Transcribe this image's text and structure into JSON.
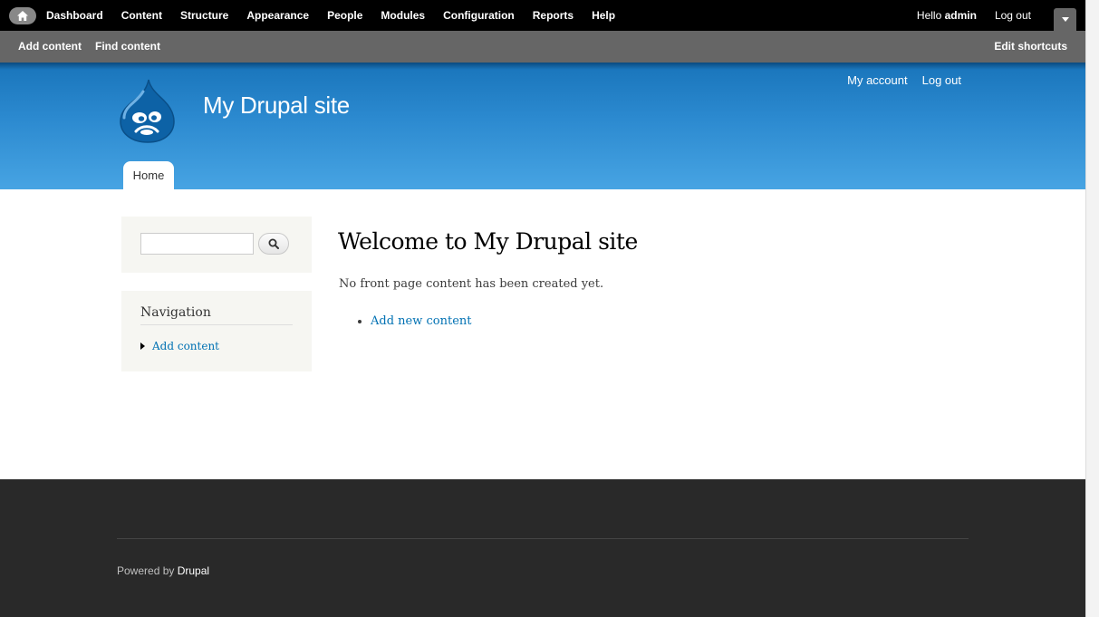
{
  "toolbar": {
    "menu": [
      "Dashboard",
      "Content",
      "Structure",
      "Appearance",
      "People",
      "Modules",
      "Configuration",
      "Reports",
      "Help"
    ],
    "hello_prefix": "Hello ",
    "username": "admin",
    "logout": "Log out"
  },
  "shortcuts": {
    "items": [
      "Add content",
      "Find content"
    ],
    "edit": "Edit shortcuts"
  },
  "header": {
    "site_name": "My Drupal site",
    "secondary_menu": [
      "My account",
      "Log out"
    ],
    "main_menu": [
      "Home"
    ]
  },
  "sidebar": {
    "search": {
      "value": "",
      "placeholder": ""
    },
    "navigation": {
      "title": "Navigation",
      "items": [
        "Add content"
      ]
    }
  },
  "main": {
    "title": "Welcome to My Drupal site",
    "message": "No front page content has been created yet.",
    "links": [
      "Add new content"
    ]
  },
  "footer": {
    "powered_prefix": "Powered by ",
    "powered_link": "Drupal"
  },
  "colors": {
    "header_blue": "#2b89cf",
    "link_blue": "#0071b3",
    "footer_bg": "#292929",
    "toolbar_bg": "#000000",
    "shortcuts_bg": "#666666"
  },
  "icons": {
    "home": "home-icon",
    "search": "search-icon",
    "drawer": "chevron-down-icon",
    "logo": "drupal-drop-logo"
  }
}
